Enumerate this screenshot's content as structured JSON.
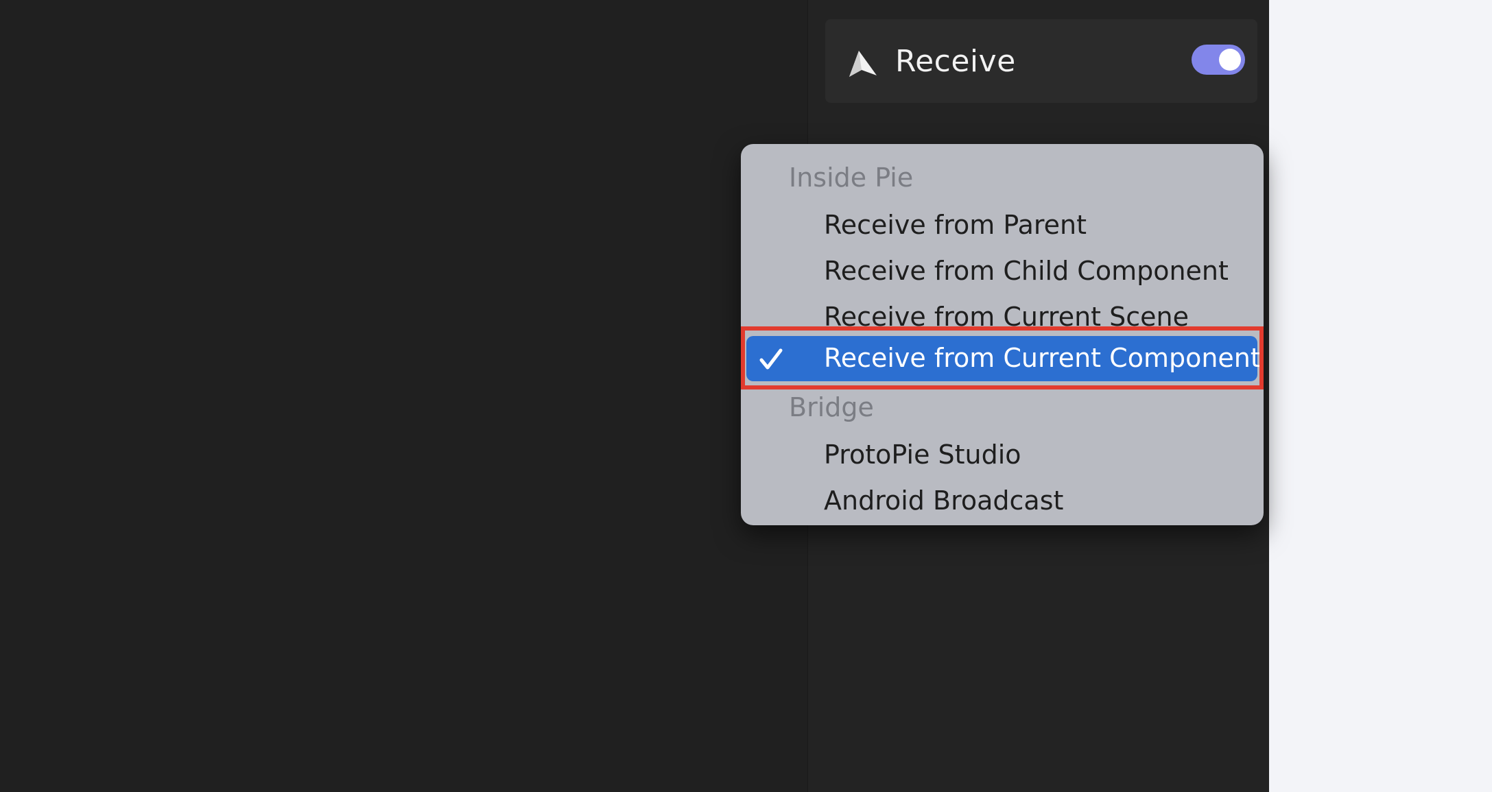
{
  "trigger": {
    "title": "Receive",
    "icon": "paper-plane-icon",
    "toggle_on": true,
    "toggle_color": "#8286ea"
  },
  "dropdown": {
    "groups": [
      {
        "header": "Inside Pie",
        "items": [
          {
            "label": "Receive from Parent",
            "selected": false
          },
          {
            "label": "Receive from Child Component",
            "selected": false
          },
          {
            "label": "Receive from Current Scene",
            "selected": false
          },
          {
            "label": "Receive from Current Component",
            "selected": true
          }
        ]
      },
      {
        "header": "Bridge",
        "items": [
          {
            "label": "ProtoPie Studio",
            "selected": false
          },
          {
            "label": "Android Broadcast",
            "selected": false
          }
        ]
      }
    ],
    "selected_color": "#2c6fd1",
    "highlight_color": "#e23b2e"
  }
}
